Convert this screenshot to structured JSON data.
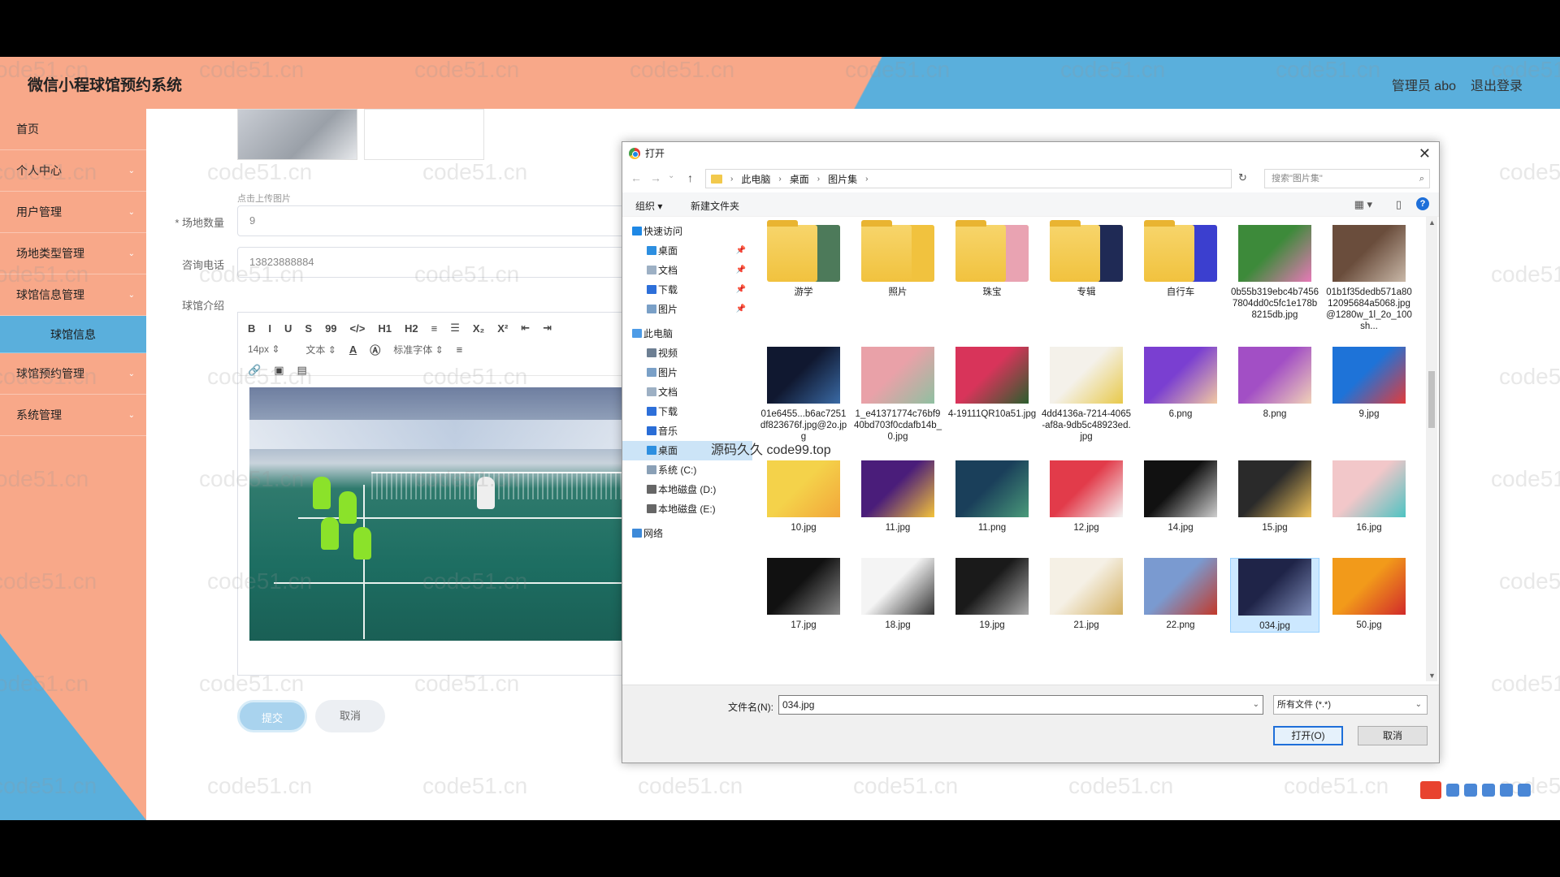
{
  "header": {
    "title": "微信小程球馆预约系统",
    "user": "管理员 abo",
    "logout": "退出登录"
  },
  "sidebar": {
    "items": [
      {
        "label": "首页",
        "has_chevron": false
      },
      {
        "label": "个人中心",
        "has_chevron": true
      },
      {
        "label": "用户管理",
        "has_chevron": true
      },
      {
        "label": "场地类型管理",
        "has_chevron": true
      },
      {
        "label": "球馆信息管理",
        "has_chevron": true
      },
      {
        "label": "球馆信息",
        "sub": true
      },
      {
        "label": "球馆预约管理",
        "has_chevron": true
      },
      {
        "label": "系统管理",
        "has_chevron": true
      }
    ],
    "chevron_glyph": "⌄"
  },
  "form": {
    "upload_hint": "点击上传图片",
    "field_count_label": "* 场地数量",
    "field_count_value": "9",
    "phone_label": "咨询电话",
    "phone_value": "13823888884",
    "intro_label": "球馆介绍",
    "toolbar_row1": [
      "B",
      "I",
      "U",
      "S",
      "99",
      "</>",
      "H1",
      "H2",
      "≡",
      "☰",
      "X₂",
      "X²",
      "⇤",
      "⇥"
    ],
    "toolbar_row2": {
      "size": "14px",
      "type": "文本",
      "font": "标准字体"
    },
    "submit": "提交",
    "cancel": "取消"
  },
  "watermark": "code51.cn",
  "overlay_text": "源码久久 code99.top",
  "dialog": {
    "title": "打开",
    "close": "✕",
    "breadcrumb": [
      "此电脑",
      "桌面",
      "图片集"
    ],
    "search_placeholder": "搜索\"图片集\"",
    "toolbar": {
      "organize": "组织 ▾",
      "new_folder": "新建文件夹"
    },
    "nav": [
      {
        "label": "快速访问",
        "top": true,
        "color": "#1e88e5"
      },
      {
        "label": "桌面",
        "color": "#2d8fe0",
        "pin": "📌"
      },
      {
        "label": "文档",
        "color": "#9db0c4",
        "pin": "📌"
      },
      {
        "label": "下载",
        "color": "#2d6fd9",
        "pin": "📌"
      },
      {
        "label": "图片",
        "color": "#7aa0c7",
        "pin": "📌"
      },
      {
        "label": "此电脑",
        "top": true,
        "color": "#4d9be6"
      },
      {
        "label": "视频",
        "color": "#6d7f93"
      },
      {
        "label": "图片",
        "color": "#7aa0c7"
      },
      {
        "label": "文档",
        "color": "#9db0c4"
      },
      {
        "label": "下载",
        "color": "#2d6fd9"
      },
      {
        "label": "音乐",
        "color": "#2a6dd6"
      },
      {
        "label": "桌面",
        "color": "#2d8fe0",
        "selected": true
      },
      {
        "label": "系统 (C:)",
        "color": "#8aa0b6"
      },
      {
        "label": "本地磁盘 (D:)",
        "color": "#666"
      },
      {
        "label": "本地磁盘 (E:)",
        "color": "#666"
      },
      {
        "label": "网络",
        "top": true,
        "color": "#3d8ad9"
      }
    ],
    "files": [
      {
        "name": "游学",
        "folder": true,
        "tint": "#4d7a5a"
      },
      {
        "name": "照片",
        "folder": true,
        "tint": "#f1c23e"
      },
      {
        "name": "珠宝",
        "folder": true,
        "tint": "#e9a3b2"
      },
      {
        "name": "专辑",
        "folder": true,
        "tint": "#1f2a55"
      },
      {
        "name": "自行车",
        "folder": true,
        "tint": "#3b3fcf"
      },
      {
        "name": "0b55b319ebc4b74567804dd0c5fc1e178b8215db.jpg",
        "colors": [
          "#3d8a3a",
          "#e879b8"
        ]
      },
      {
        "name": "01b1f35dedb571a8012095684a5068.jpg@1280w_1l_2o_100sh...",
        "colors": [
          "#6a4d3c",
          "#c9b8a8"
        ]
      },
      {
        "name": "01e6455...b6ac7251df823676f.jpg@2o.jpg",
        "colors": [
          "#101830",
          "#3a6aa5"
        ]
      },
      {
        "name": "1_e41371774c76bf940bd703f0cdafb14b_0.jpg",
        "colors": [
          "#e9a1a8",
          "#8fc0a1"
        ]
      },
      {
        "name": "4-19111QR10a51.jpg",
        "colors": [
          "#d8345a",
          "#2b5f2e"
        ]
      },
      {
        "name": "4dd4136a-7214-4065-af8a-9db5c48923ed.jpg",
        "colors": [
          "#f4f1ea",
          "#e8c94a"
        ]
      },
      {
        "name": "6.png",
        "colors": [
          "#7a3fd1",
          "#f2c8a2"
        ]
      },
      {
        "name": "8.png",
        "colors": [
          "#a24fc5",
          "#f1d2b8"
        ]
      },
      {
        "name": "9.jpg",
        "colors": [
          "#1e73d8",
          "#e23b3b"
        ]
      },
      {
        "name": "10.jpg",
        "colors": [
          "#f4d24a",
          "#f2a63a"
        ]
      },
      {
        "name": "11.jpg",
        "colors": [
          "#4a1d7a",
          "#f4c33a"
        ]
      },
      {
        "name": "11.png",
        "colors": [
          "#1a3f5a",
          "#4a9a7a"
        ]
      },
      {
        "name": "12.jpg",
        "colors": [
          "#e23b4a",
          "#f4f4f4"
        ]
      },
      {
        "name": "14.jpg",
        "colors": [
          "#111111",
          "#cfcfcf"
        ]
      },
      {
        "name": "15.jpg",
        "colors": [
          "#2a2a2a",
          "#f0c35a"
        ]
      },
      {
        "name": "16.jpg",
        "colors": [
          "#f2c7c9",
          "#4ec3c2"
        ]
      },
      {
        "name": "17.jpg",
        "colors": [
          "#111111",
          "#888888"
        ]
      },
      {
        "name": "18.jpg",
        "colors": [
          "#f4f4f4",
          "#333333"
        ]
      },
      {
        "name": "19.jpg",
        "colors": [
          "#1a1a1a",
          "#aaaaaa"
        ]
      },
      {
        "name": "21.jpg",
        "colors": [
          "#f5f0e5",
          "#d4b060"
        ]
      },
      {
        "name": "22.png",
        "colors": [
          "#7a9ad0",
          "#c2392a"
        ]
      },
      {
        "name": "034.jpg",
        "colors": [
          "#1f2448",
          "#7e8cb8"
        ],
        "selected": true
      },
      {
        "name": "50.jpg",
        "colors": [
          "#f29a1a",
          "#d12a2a"
        ]
      }
    ],
    "filename_label": "文件名(N):",
    "filename_value": "034.jpg",
    "filter": "所有文件 (*.*)",
    "open": "打开(O)",
    "cancel": "取消"
  }
}
